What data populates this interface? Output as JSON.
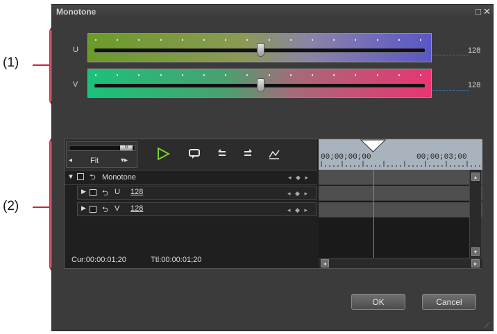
{
  "callouts": {
    "one": "(1)",
    "two": "(2)"
  },
  "window": {
    "title": "Monotone",
    "restore_glyph": "□",
    "close_glyph": "✕"
  },
  "sliders": {
    "u": {
      "label": "U",
      "value": "128",
      "level": 0.5
    },
    "v": {
      "label": "V",
      "value": "128",
      "level": 0.5
    }
  },
  "toolbar": {
    "zoom_label": "Fit",
    "zoom_thumb": "III",
    "play_icon": "play-icon",
    "comment_icon": "comment-icon",
    "undo_icon": "undo-icon",
    "redo_icon": "redo-icon",
    "graph_icon": "graph-icon"
  },
  "tracks": [
    {
      "name": "Monotone",
      "value": ""
    },
    {
      "name": "U",
      "value": "128"
    },
    {
      "name": "V",
      "value": "128"
    }
  ],
  "keyframe_controls": "◂ ◆ ▸",
  "timeline": {
    "mark0": "00;00;00;00",
    "mark1": "00;00;03;00"
  },
  "status": {
    "cur": "Cur:00:00:01;20",
    "ttl": "Ttl:00:00:01;20"
  },
  "buttons": {
    "ok": "OK",
    "cancel": "Cancel"
  },
  "colors": {
    "accent": "#c0283a",
    "playhead": "#3fa7a3"
  }
}
